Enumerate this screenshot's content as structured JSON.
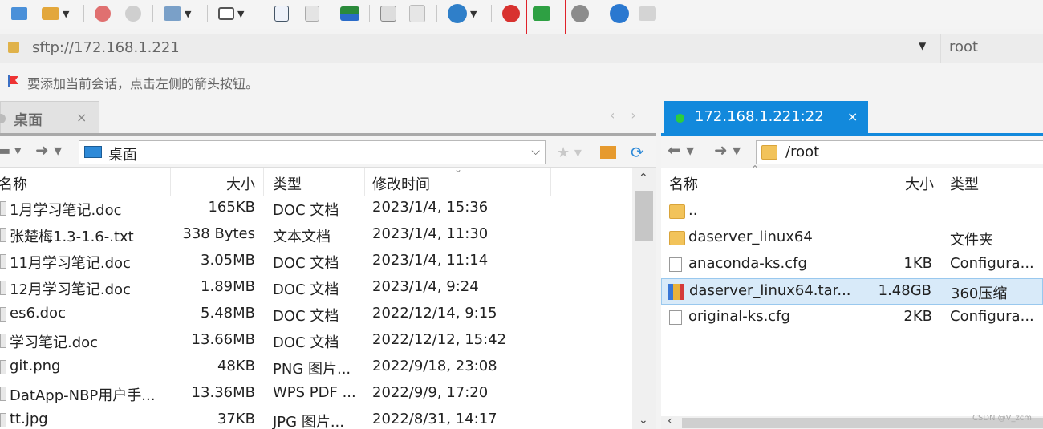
{
  "address": {
    "url": "sftp://172.168.1.221",
    "user": "root"
  },
  "hint": {
    "text": "要添加当前会话，点击左侧的箭头按钮。"
  },
  "left_pane": {
    "tab_title": "桌面",
    "tab_close": "×",
    "path": "桌面",
    "columns": [
      "名称",
      "大小",
      "类型",
      "修改时间"
    ],
    "files": [
      {
        "name": "1月学习笔记.doc",
        "size": "165KB",
        "type": "DOC 文档",
        "modified": "2023/1/4, 15:36"
      },
      {
        "name": "张楚梅1.3-1.6-.txt",
        "size": "338 Bytes",
        "type": "文本文档",
        "modified": "2023/1/4, 11:30"
      },
      {
        "name": "11月学习笔记.doc",
        "size": "3.05MB",
        "type": "DOC 文档",
        "modified": "2023/1/4, 11:14"
      },
      {
        "name": "12月学习笔记.doc",
        "size": "1.89MB",
        "type": "DOC 文档",
        "modified": "2023/1/4, 9:24"
      },
      {
        "name": "es6.doc",
        "size": "5.48MB",
        "type": "DOC 文档",
        "modified": "2022/12/14, 9:15"
      },
      {
        "name": "学习笔记.doc",
        "size": "13.66MB",
        "type": "DOC 文档",
        "modified": "2022/12/12, 15:42"
      },
      {
        "name": "git.png",
        "size": "48KB",
        "type": "PNG 图片...",
        "modified": "2022/9/18, 23:08"
      },
      {
        "name": "DatApp-NBP用户手...",
        "size": "13.36MB",
        "type": "WPS PDF ...",
        "modified": "2022/9/9, 17:20"
      },
      {
        "name": "tt.jpg",
        "size": "37KB",
        "type": "JPG 图片...",
        "modified": "2022/8/31, 14:17"
      }
    ]
  },
  "right_pane": {
    "tab_title": "172.168.1.221:22",
    "tab_close": "×",
    "path": "/root",
    "columns": [
      "名称",
      "大小",
      "类型"
    ],
    "files": [
      {
        "name": "..",
        "size": "",
        "type": ""
      },
      {
        "name": "daserver_linux64",
        "size": "",
        "type": "文件夹"
      },
      {
        "name": "anaconda-ks.cfg",
        "size": "1KB",
        "type": "Configura..."
      },
      {
        "name": "daserver_linux64.tar...",
        "size": "1.48GB",
        "type": "360压缩"
      },
      {
        "name": "original-ks.cfg",
        "size": "2KB",
        "type": "Configura..."
      }
    ]
  },
  "watermark": "CSDN @V_zcm",
  "colors": {
    "accent": "#1289dc",
    "highlight_box": "#e0222a",
    "selected_row": "#d8eaf9"
  }
}
